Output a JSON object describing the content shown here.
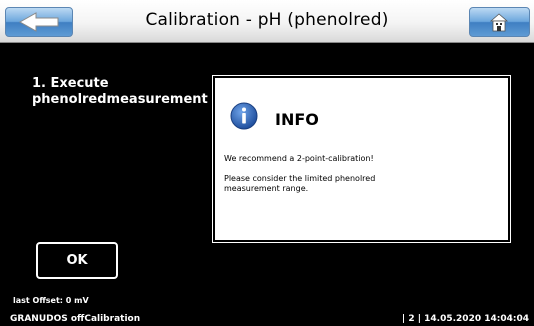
{
  "header": {
    "title": "Calibration - pH (phenolred)",
    "back_icon": "left-arrow-icon",
    "home_icon": "home-icon"
  },
  "step": {
    "line1": "1. Execute",
    "line2": "phenolredmeasurement"
  },
  "dialog": {
    "icon": "info-icon",
    "title": "INFO",
    "message1": "We recommend a 2-point-calibration!",
    "message2": "Please consider the limited phenolred measurement range."
  },
  "ok_button": {
    "label": "OK"
  },
  "status": {
    "offset": "last Offset: 0 mV",
    "left": "GRANUDOS offCalibration",
    "right": "| 2 | 14.05.2020 14:04:04"
  },
  "colors": {
    "header_bg": "#f4f4f4",
    "button_blue": "#4f8fcf",
    "info_blue": "#2b5fb3"
  }
}
